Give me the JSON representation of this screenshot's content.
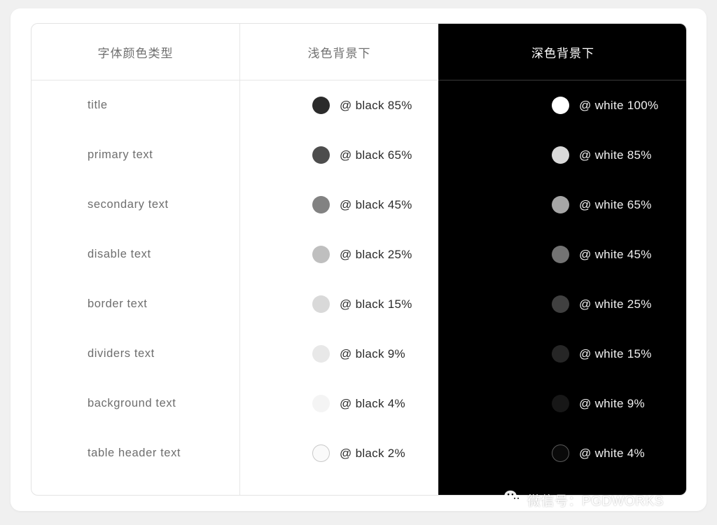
{
  "table": {
    "headers": {
      "type_column": "字体颜色类型",
      "light_column": "浅色背景下",
      "dark_column": "深色背景下"
    },
    "rows": [
      {
        "name": "title",
        "light": {
          "token": "@ black 85%",
          "swatch": "#2b2b2b",
          "ring": false
        },
        "dark": {
          "token": "@ white 100%",
          "swatch": "#ffffff",
          "ring": false
        }
      },
      {
        "name": "primary text",
        "light": {
          "token": "@ black 65%",
          "swatch": "#4d4d4d",
          "ring": false
        },
        "dark": {
          "token": "@ white 85%",
          "swatch": "#d9d9d9",
          "ring": false
        }
      },
      {
        "name": "secondary text",
        "light": {
          "token": "@ black 45%",
          "swatch": "#828282",
          "ring": false
        },
        "dark": {
          "token": "@ white 65%",
          "swatch": "#a6a6a6",
          "ring": false
        }
      },
      {
        "name": "disable text",
        "light": {
          "token": "@ black 25%",
          "swatch": "#bfbfbf",
          "ring": false
        },
        "dark": {
          "token": "@ white 45%",
          "swatch": "#737373",
          "ring": false
        }
      },
      {
        "name": "border text",
        "light": {
          "token": "@ black 15%",
          "swatch": "#d9d9d9",
          "ring": false
        },
        "dark": {
          "token": "@ white 25%",
          "swatch": "#404040",
          "ring": false
        }
      },
      {
        "name": "dividers text",
        "light": {
          "token": "@ black 9%",
          "swatch": "#e8e8e8",
          "ring": false
        },
        "dark": {
          "token": "@ white 15%",
          "swatch": "#262626",
          "ring": false
        }
      },
      {
        "name": "background text",
        "light": {
          "token": "@ black 4%",
          "swatch": "#f4f4f4",
          "ring": false
        },
        "dark": {
          "token": "@ white 9%",
          "swatch": "#171717",
          "ring": false
        }
      },
      {
        "name": "table header text",
        "light": {
          "token": "@ black 2%",
          "swatch": "#fafafa",
          "ring": true,
          "ring_color": "#c9c9c9"
        },
        "dark": {
          "token": "@ white 4%",
          "swatch": "#0a0a0a",
          "ring": true,
          "ring_color": "#5a5a5a"
        }
      }
    ]
  },
  "watermark": {
    "icon": "wechat-icon",
    "text": "微信号：PGDWORKS"
  }
}
